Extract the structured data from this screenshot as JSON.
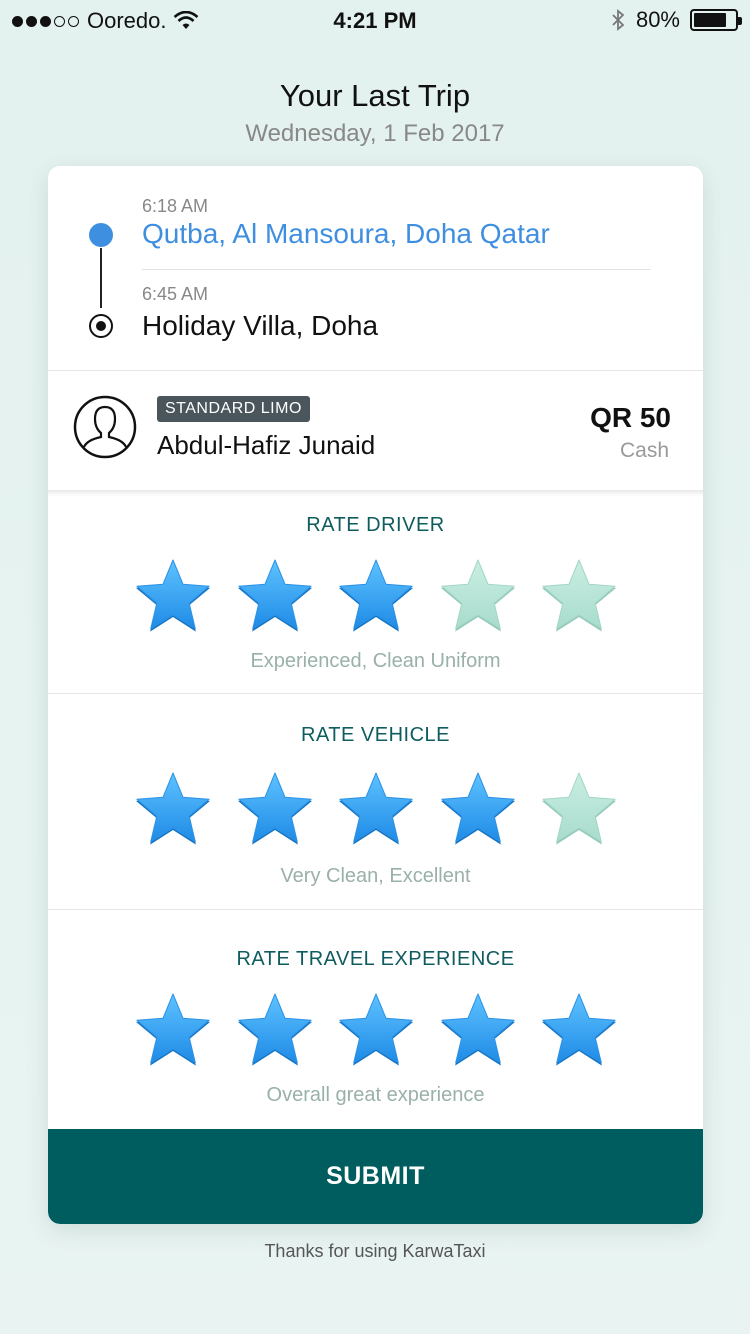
{
  "status_bar": {
    "carrier": "Ooredo.",
    "time": "4:21 PM",
    "battery": "80%",
    "battery_level": 0.8
  },
  "header": {
    "title": "Your Last Trip",
    "date": "Wednesday, 1 Feb 2017"
  },
  "trip": {
    "pickup_time": "6:18 AM",
    "pickup_place": "Qutba, Al Mansoura, Doha Qatar",
    "drop_time": "6:45 AM",
    "drop_place": "Holiday Villa, Doha"
  },
  "driver": {
    "car_type": "STANDARD LIMO",
    "name": "Abdul-Hafiz Junaid",
    "fare": "QR 50",
    "payment": "Cash"
  },
  "ratings": [
    {
      "title": "RATE DRIVER",
      "rating": 3,
      "max": 5,
      "caption": "Experienced, Clean Uniform"
    },
    {
      "title": "RATE VEHICLE",
      "rating": 4,
      "max": 5,
      "caption": "Very Clean, Excellent"
    },
    {
      "title": "RATE TRAVEL EXPERIENCE",
      "rating": 5,
      "max": 5,
      "caption": "Overall great experience"
    }
  ],
  "submit_label": "SUBMIT",
  "footer": "Thanks for using KarwaTaxi",
  "colors": {
    "accent_blue": "#3f8fe0",
    "brand_teal": "#005d5f",
    "star_filled": "#2f9df0",
    "star_empty": "#b3e3d6"
  },
  "icons": {
    "avatar": "user-avatar-icon",
    "star": "star-icon",
    "wifi": "wifi-icon",
    "bluetooth": "bluetooth-icon"
  }
}
